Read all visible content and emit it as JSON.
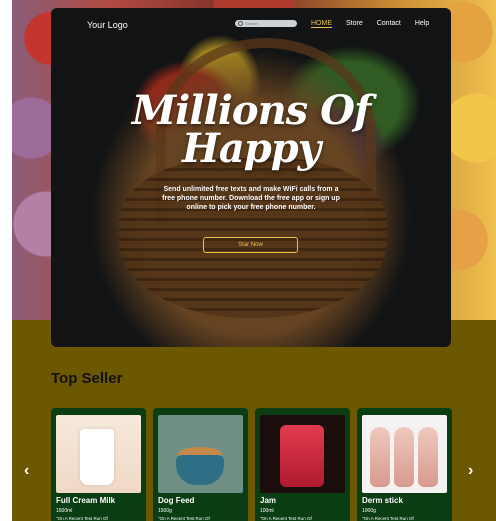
{
  "nav": {
    "logo": "Your Logo",
    "search_placeholder": "Search",
    "links": [
      {
        "label": "HOME",
        "active": true
      },
      {
        "label": "Store",
        "active": false
      },
      {
        "label": "Contact",
        "active": false
      },
      {
        "label": "Help",
        "active": false
      }
    ]
  },
  "hero": {
    "title_line1": "Millions Of",
    "title_line2": "Happy",
    "description": "Send unlimited free texts and make WiFi calls from a free phone number. Download the free app or sign up online to pick your free phone number.",
    "cta_label": "Star Now"
  },
  "section": {
    "title": "Top Seller"
  },
  "arrows": {
    "prev": "‹",
    "next": "›"
  },
  "products": [
    {
      "name": "Full Cream Milk",
      "size": "1500ml",
      "desc": "\"On A Recent Test Run Of"
    },
    {
      "name": "Dog Feed",
      "size": "1500g",
      "desc": "\"On A Recent Test Run Of"
    },
    {
      "name": "Jam",
      "size": "100ml",
      "desc": "\"On A Recent Test Run Of"
    },
    {
      "name": "Derm stick",
      "size": "1000g",
      "desc": "\"On A Recent Test Run Of"
    }
  ],
  "colors": {
    "accent": "#e8c24a",
    "section_bg": "#6b5800",
    "card_bg": "#0a3d12"
  }
}
